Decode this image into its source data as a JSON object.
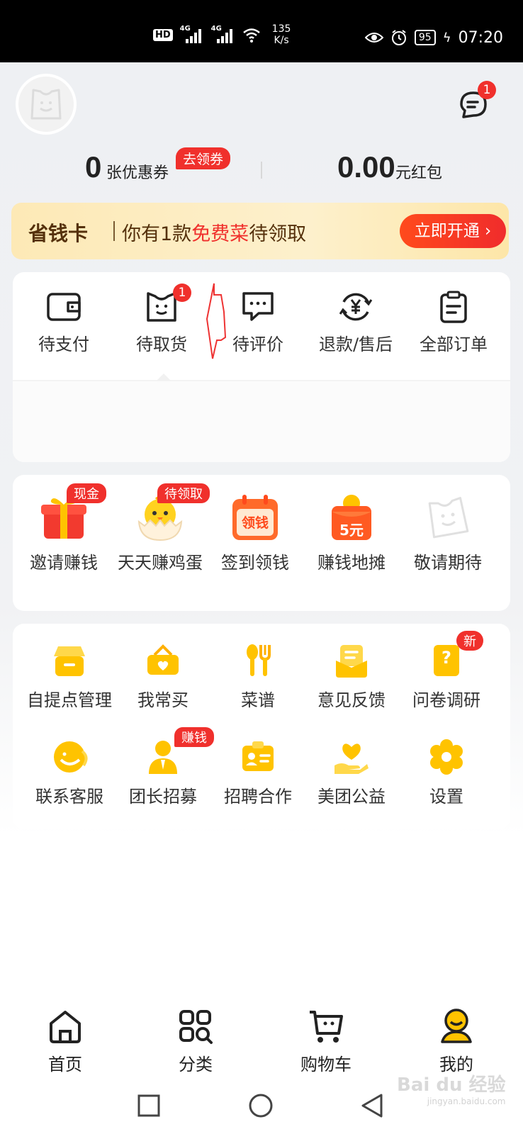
{
  "status_bar": {
    "hd": "HD",
    "net1": "4G",
    "net2": "4G",
    "speed_value": "135",
    "speed_unit": "K/s",
    "battery": "95",
    "time": "07:20"
  },
  "header": {
    "message_badge": "1"
  },
  "coupons": {
    "count": "0",
    "count_unit": "张优惠券",
    "collect_tag": "去领券",
    "redpacket_amount": "0.00",
    "redpacket_unit": "元红包"
  },
  "savecard": {
    "title": "省钱卡",
    "desc_prefix": "你有1款",
    "desc_highlight": "免费菜",
    "desc_suffix": "待领取",
    "button": "立即开通 ›"
  },
  "orders": {
    "items": [
      {
        "label": "待支付",
        "icon": "wallet-icon"
      },
      {
        "label": "待取货",
        "icon": "pickup-bag-icon",
        "badge": "1"
      },
      {
        "label": "待评价",
        "icon": "comment-icon"
      },
      {
        "label": "退款/售后",
        "icon": "refund-icon"
      },
      {
        "label": "全部订单",
        "icon": "clipboard-icon"
      }
    ]
  },
  "earn": {
    "items": [
      {
        "label": "邀请赚钱",
        "icon": "gift-icon",
        "tag": "现金"
      },
      {
        "label": "天天赚鸡蛋",
        "icon": "chick-icon",
        "tag": "待领取"
      },
      {
        "label": "签到领钱",
        "icon": "calendar-icon",
        "icon_text": "领钱"
      },
      {
        "label": "赚钱地摊",
        "icon": "red-envelope-icon",
        "icon_text": "5元"
      },
      {
        "label": "敬请期待",
        "icon": "placeholder-bag-icon"
      }
    ]
  },
  "tools": {
    "items": [
      {
        "label": "自提点管理",
        "icon": "store-icon"
      },
      {
        "label": "我常买",
        "icon": "basket-icon"
      },
      {
        "label": "菜谱",
        "icon": "spoon-fork-icon"
      },
      {
        "label": "意见反馈",
        "icon": "feedback-icon"
      },
      {
        "label": "问卷调研",
        "icon": "survey-icon",
        "tag": "新"
      },
      {
        "label": "联系客服",
        "icon": "service-icon"
      },
      {
        "label": "团长招募",
        "icon": "leader-icon",
        "tag": "赚钱"
      },
      {
        "label": "招聘合作",
        "icon": "id-card-icon"
      },
      {
        "label": "美团公益",
        "icon": "charity-icon"
      },
      {
        "label": "设置",
        "icon": "settings-icon"
      }
    ]
  },
  "bottom_nav": {
    "items": [
      {
        "label": "首页",
        "icon": "home-icon"
      },
      {
        "label": "分类",
        "icon": "category-icon"
      },
      {
        "label": "购物车",
        "icon": "cart-icon"
      },
      {
        "label": "我的",
        "icon": "profile-icon"
      }
    ]
  },
  "watermark": {
    "brand": "Bai du 经验",
    "url": "jingyan.baidu.com"
  },
  "colors": {
    "accent_red": "#f0302c",
    "brand_yellow": "#ffc300",
    "savecard_text": "#55310c"
  }
}
